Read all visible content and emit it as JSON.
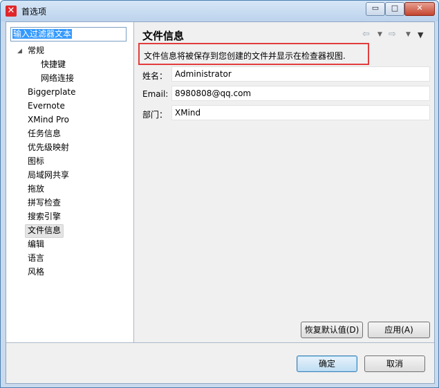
{
  "window": {
    "title": "首选项",
    "controls": {
      "minimize": "▭",
      "maximize": "□",
      "close": "✕"
    }
  },
  "sidebar": {
    "filter_text": "输入过滤器文本",
    "items": [
      {
        "label": "常规",
        "expanded": true
      },
      {
        "label": "快捷键",
        "child": true
      },
      {
        "label": "网络连接",
        "child": true
      },
      {
        "label": "Biggerplate"
      },
      {
        "label": "Evernote"
      },
      {
        "label": "XMind Pro"
      },
      {
        "label": "任务信息"
      },
      {
        "label": "优先级映射"
      },
      {
        "label": "图标"
      },
      {
        "label": "局域网共享"
      },
      {
        "label": "拖放"
      },
      {
        "label": "拼写检查"
      },
      {
        "label": "搜索引擎"
      },
      {
        "label": "文件信息",
        "selected": true
      },
      {
        "label": "编辑"
      },
      {
        "label": "语言"
      },
      {
        "label": "风格"
      }
    ]
  },
  "page": {
    "title": "文件信息",
    "nav_icons": [
      "back-arrow-icon",
      "dropdown-icon",
      "forward-arrow-icon",
      "dropdown-icon",
      "menu-icon"
    ],
    "description": "文件信息将被保存到您创建的文件并显示在检查器视图.",
    "fields": [
      {
        "label": "姓名：",
        "value": "Administrator"
      },
      {
        "label": "Email:",
        "value": "8980808@qq.com"
      },
      {
        "label": "部门：",
        "value": "XMind"
      }
    ],
    "restore_defaults_label": "恢复默认值(D)",
    "apply_label": "应用(A)"
  },
  "footer": {
    "ok_label": "确定",
    "cancel_label": "取消"
  },
  "colors": {
    "highlight_box": "#e23c3c",
    "selection": "#3399ff"
  }
}
